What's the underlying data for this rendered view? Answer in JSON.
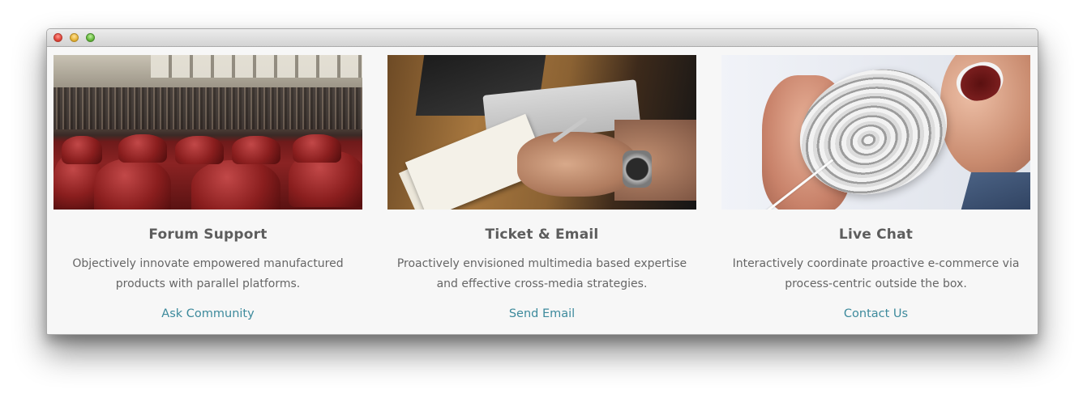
{
  "cards": [
    {
      "title": "Forum Support",
      "description": "Objectively innovate empowered manufactured products with parallel platforms.",
      "link": "Ask Community",
      "image": "stadium-red-seats-photo"
    },
    {
      "title": "Ticket & Email",
      "description": "Proactively envisioned multimedia based expertise and effective cross-media strategies.",
      "link": "Send Email",
      "image": "writing-notebook-photo"
    },
    {
      "title": "Live Chat",
      "description": "Interactively coordinate proactive e-commerce via process-centric outside the box.",
      "link": "Contact Us",
      "image": "tin-can-phone-photo"
    }
  ],
  "colors": {
    "title": "#5d5d5d",
    "text": "#666666",
    "link": "#3d8a9c",
    "background": "#f7f7f7"
  }
}
